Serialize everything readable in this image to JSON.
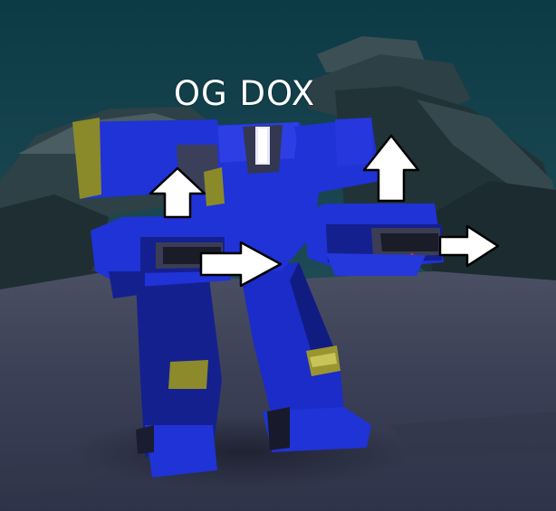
{
  "player_name": "OG DOX",
  "colors": {
    "sky_top": "#0d3c46",
    "sky_bottom": "#2d5560",
    "ground": "#3a3f53",
    "mech_blue": "#1d2fd0",
    "mech_dark_blue": "#13208f",
    "mech_gray": "#3c3f5a",
    "mech_yellow": "#8a8a2a",
    "arrow_fill": "#ffffff",
    "arrow_stroke": "#000000",
    "name_text": "#ffffff"
  },
  "annotation_arrows": [
    {
      "direction": "up",
      "icon": "arrow-up-icon"
    },
    {
      "direction": "up",
      "icon": "arrow-up-icon"
    },
    {
      "direction": "right",
      "icon": "arrow-right-icon"
    },
    {
      "direction": "right",
      "icon": "arrow-right-icon"
    }
  ]
}
